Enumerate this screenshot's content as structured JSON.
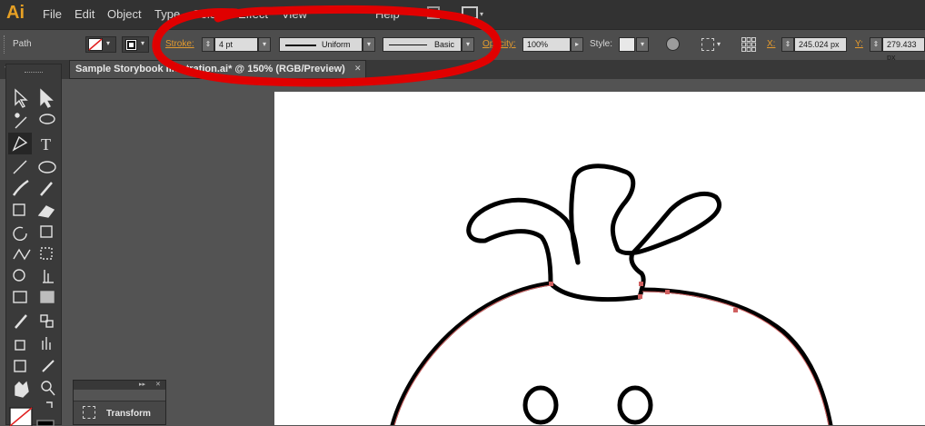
{
  "app": {
    "logo": "Ai"
  },
  "menu": [
    "File",
    "Edit",
    "Object",
    "Type",
    "Select",
    "Effect",
    "View",
    "Help"
  ],
  "control_bar": {
    "selection_type": "Path",
    "stroke_label": "Stroke:",
    "stroke_weight": "4 pt",
    "variable_width_profile": "Uniform",
    "brush_definition": "Basic",
    "opacity_label": "Opacity:",
    "opacity_value": "100%",
    "style_label": "Style:",
    "x_label": "X:",
    "x_value": "245.024 px",
    "y_label": "Y:",
    "y_value": "279.433 px"
  },
  "document_tab": {
    "title": "Sample Storybook Illustration.ai* @ 150% (RGB/Preview)",
    "close_glyph": "✕"
  },
  "panels": {
    "transform": {
      "label": "Transform"
    }
  },
  "colors": {
    "annotation": "#e00000",
    "accent_orange": "#e39a2e",
    "artboard": "#ffffff",
    "path_highlight": "#d06060"
  },
  "annotation": {
    "shape": "hand-drawn circle around stroke settings"
  }
}
